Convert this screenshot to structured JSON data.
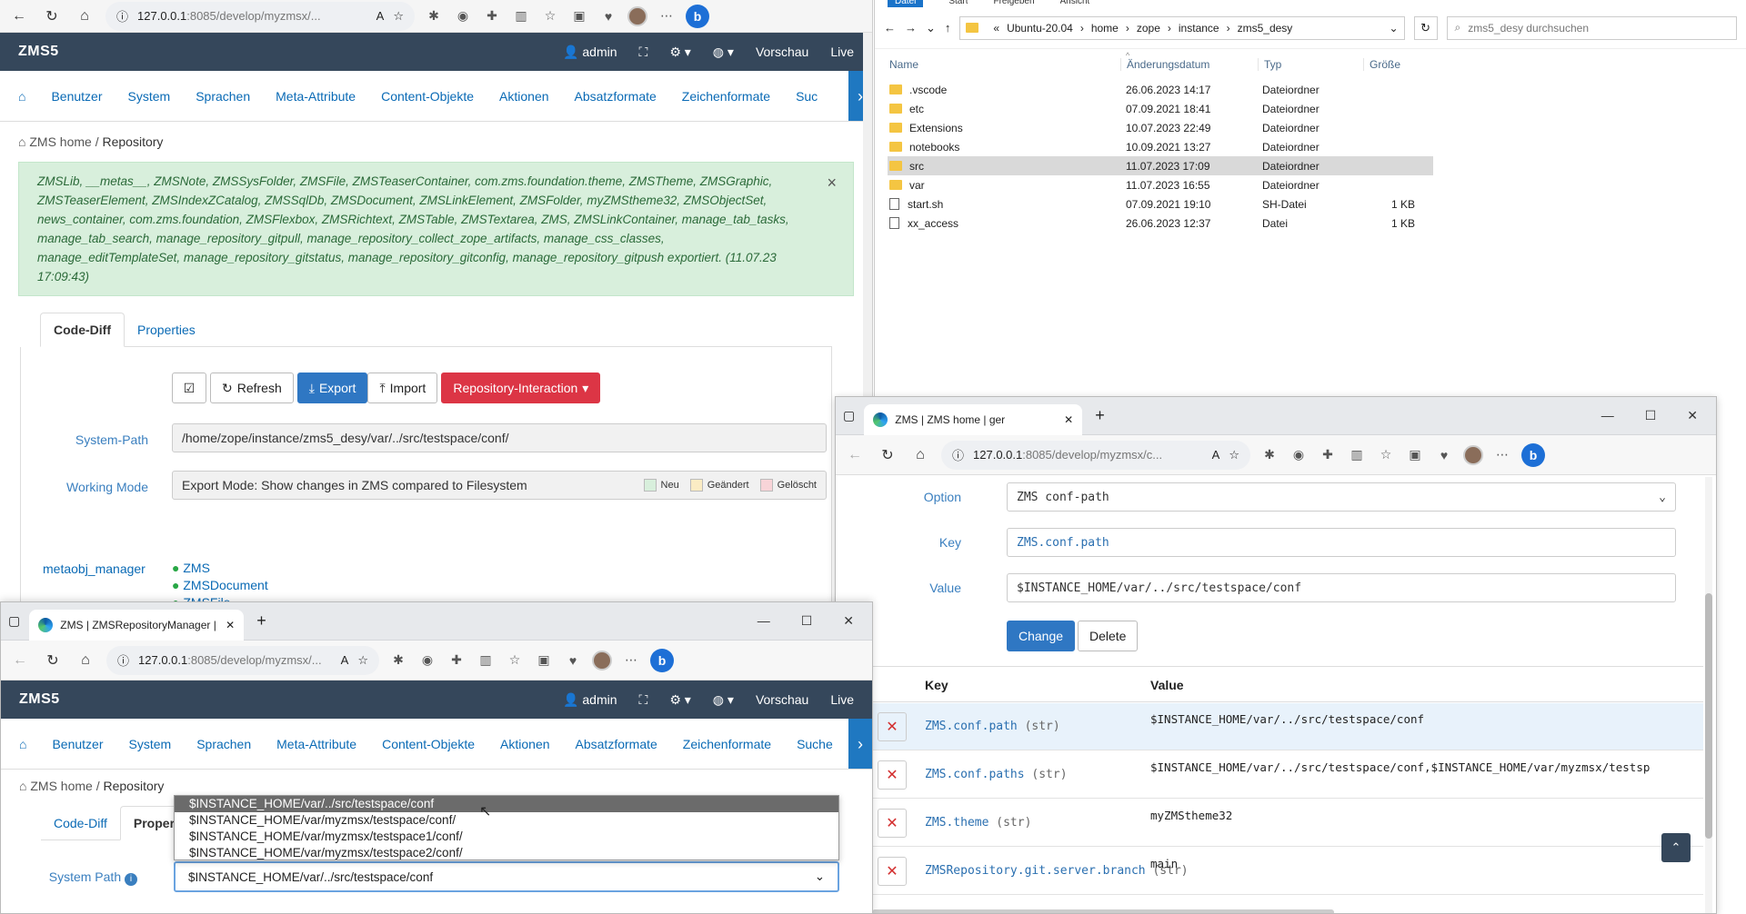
{
  "colors": {
    "zms_header": "#35475b",
    "link": "#0a6ab5",
    "primary": "#2f77c3",
    "danger": "#dc3545",
    "success_bg": "#d8efdc"
  },
  "browser_main": {
    "url_host": "127.0.0.1",
    "url_rest": ":8085/develop/myzmsx/...",
    "zms": {
      "brand": "ZMS5",
      "user": "admin",
      "right_items": [
        "Vorschau",
        "Live"
      ],
      "menu": [
        "Benutzer",
        "System",
        "Sprachen",
        "Meta-Attribute",
        "Content-Objekte",
        "Aktionen",
        "Absatzformate",
        "Zeichenformate",
        "Suc"
      ],
      "breadcrumb": {
        "home": "ZMS home",
        "sep": "/",
        "current": "Repository"
      },
      "alert_text": "ZMSLib, __metas__, ZMSNote, ZMSSysFolder, ZMSFile, ZMSTeaserContainer, com.zms.foundation.theme, ZMSTheme, ZMSGraphic, ZMSTeaserElement, ZMSIndexZCatalog, ZMSSqlDb, ZMSDocument, ZMSLinkElement, ZMSFolder, myZMStheme32, ZMSObjectSet, news_container, com.zms.foundation, ZMSFlexbox, ZMSRichtext, ZMSTable, ZMSTextarea, ZMS, ZMSLinkContainer, manage_tab_tasks, manage_tab_search, manage_repository_gitpull, manage_repository_collect_zope_artifacts, manage_css_classes, manage_editTemplateSet, manage_repository_gitstatus, manage_repository_gitconfig, manage_repository_gitpush exportiert. (11.07.23 17:09:43)",
      "alert_close": "×",
      "tabs": [
        "Code-Diff",
        "Properties"
      ],
      "buttons": {
        "refresh": "Refresh",
        "export": "Export",
        "import": "Import",
        "repo": "Repository-Interaction"
      },
      "system_path_label": "System-Path",
      "system_path_value": "/home/zope/instance/zms5_desy/var/../src/testspace/conf/",
      "working_mode_label": "Working Mode",
      "working_mode_value": "Export Mode: Show changes in ZMS compared to Filesystem",
      "legend": [
        "Neu",
        "Geändert",
        "Gelöscht"
      ],
      "tree_label": "metaobj_manager",
      "tree_items": [
        "ZMS",
        "ZMSDocument",
        "ZMSFile"
      ]
    }
  },
  "explorer": {
    "ribbon": [
      "Datei",
      "Start",
      "Freigeben",
      "Ansicht"
    ],
    "path": [
      "Ubuntu-20.04",
      "home",
      "zope",
      "instance",
      "zms5_desy"
    ],
    "search_placeholder": "zms5_desy durchsuchen",
    "columns": [
      "Name",
      "Änderungsdatum",
      "Typ",
      "Größe"
    ],
    "rows": [
      {
        "name": ".vscode",
        "date": "26.06.2023 14:17",
        "type": "Dateiordner",
        "size": ""
      },
      {
        "name": "etc",
        "date": "07.09.2021 18:41",
        "type": "Dateiordner",
        "size": ""
      },
      {
        "name": "Extensions",
        "date": "10.07.2023 22:49",
        "type": "Dateiordner",
        "size": ""
      },
      {
        "name": "notebooks",
        "date": "10.09.2021 13:27",
        "type": "Dateiordner",
        "size": ""
      },
      {
        "name": "src",
        "date": "11.07.2023 17:09",
        "type": "Dateiordner",
        "size": ""
      },
      {
        "name": "var",
        "date": "11.07.2023 16:55",
        "type": "Dateiordner",
        "size": ""
      },
      {
        "name": "start.sh",
        "date": "07.09.2021 19:10",
        "type": "SH-Datei",
        "size": "1 KB"
      },
      {
        "name": "xx_access",
        "date": "26.06.2023 12:37",
        "type": "Datei",
        "size": "1 KB"
      }
    ]
  },
  "browser_conf": {
    "tab_title": "ZMS | ZMS home | ger",
    "url_host": "127.0.0.1",
    "url_rest": ":8085/develop/myzmsx/c...",
    "option_label": "Option",
    "option_value": "ZMS conf-path",
    "key_label": "Key",
    "key_value": "ZMS.conf.path",
    "value_label": "Value",
    "value_value": "$INSTANCE_HOME/var/../src/testspace/conf",
    "change_btn": "Change",
    "delete_btn": "Delete",
    "table_headers": [
      "Key",
      "Value"
    ],
    "rows": [
      {
        "key": "ZMS.conf.path",
        "type": "(str)",
        "value": "$INSTANCE_HOME/var/../src/testspace/conf"
      },
      {
        "key": "ZMS.conf.paths",
        "type": "(str)",
        "value": "$INSTANCE_HOME/var/../src/testspace/conf,$INSTANCE_HOME/var/myzmsx/testsp"
      },
      {
        "key": "ZMS.theme",
        "type": "(str)",
        "value": "myZMStheme32"
      },
      {
        "key": "ZMSRepository.git.server.branch",
        "type": "(str)",
        "value": "main"
      }
    ]
  },
  "browser_repo": {
    "tab_title": "ZMS | ZMSRepositoryManager |",
    "url_host": "127.0.0.1",
    "url_rest": ":8085/develop/myzmsx/...",
    "zms": {
      "brand": "ZMS5",
      "user": "admin",
      "right_items": [
        "Vorschau",
        "Live"
      ],
      "menu": [
        "Benutzer",
        "System",
        "Sprachen",
        "Meta-Attribute",
        "Content-Objekte",
        "Aktionen",
        "Absatzformate",
        "Zeichenformate",
        "Suche"
      ],
      "breadcrumb": {
        "home": "ZMS home",
        "sep": "/",
        "current": "Repository"
      },
      "tabs": [
        "Code-Diff",
        "Proper"
      ],
      "system_path_label": "System Path",
      "dropdown_options": [
        "$INSTANCE_HOME/var/../src/testspace/conf",
        "$INSTANCE_HOME/var/myzmsx/testspace/conf/",
        "$INSTANCE_HOME/var/myzmsx/testspace1/conf/",
        "$INSTANCE_HOME/var/myzmsx/testspace2/conf/"
      ],
      "selected_value": "$INSTANCE_HOME/var/../src/testspace/conf"
    }
  }
}
